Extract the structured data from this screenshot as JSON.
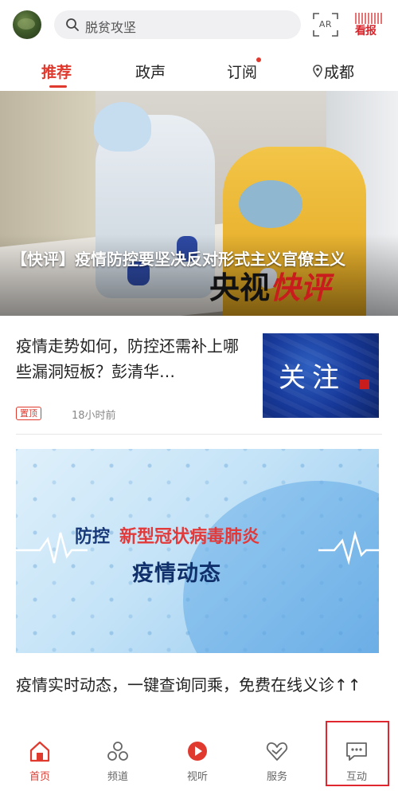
{
  "search": {
    "placeholder": "脱贫攻坚"
  },
  "ar_button": {
    "label": "AR"
  },
  "kanbao": {
    "label": "看报"
  },
  "tabs": [
    {
      "label": "推荐",
      "active": true
    },
    {
      "label": "政声",
      "active": false
    },
    {
      "label": "订阅",
      "active": false,
      "has_dot": true
    },
    {
      "label": "成都",
      "active": false,
      "icon": "location-pin-icon"
    }
  ],
  "hero": {
    "title": "【快评】疫情防控要坚决反对形式主义官僚主义",
    "brand_part1": "央视",
    "brand_part2": "快评"
  },
  "article1": {
    "title": "疫情走势如何，防控还需补上哪些漏洞短板？彭清华…",
    "tag": "置顶",
    "time": "18小时前",
    "thumb_text": "关注"
  },
  "banner": {
    "line1_a": "防控",
    "line1_b": "新型冠状病毒肺炎",
    "line2": "疫情动态"
  },
  "article2": {
    "title": "疫情实时动态，一键查询同乘，免费在线义诊↑↑"
  },
  "bottom_nav": [
    {
      "label": "首页",
      "icon": "home-icon",
      "active": true
    },
    {
      "label": "频道",
      "icon": "channels-icon",
      "active": false
    },
    {
      "label": "视听",
      "icon": "play-icon",
      "active": false
    },
    {
      "label": "服务",
      "icon": "service-icon",
      "active": false
    },
    {
      "label": "互动",
      "icon": "chat-icon",
      "active": false,
      "highlighted": true
    }
  ],
  "colors": {
    "accent": "#e03a2f",
    "text": "#222222",
    "muted": "#888888",
    "search_bg": "#f0f0f2",
    "highlight_box": "#e0272f"
  }
}
